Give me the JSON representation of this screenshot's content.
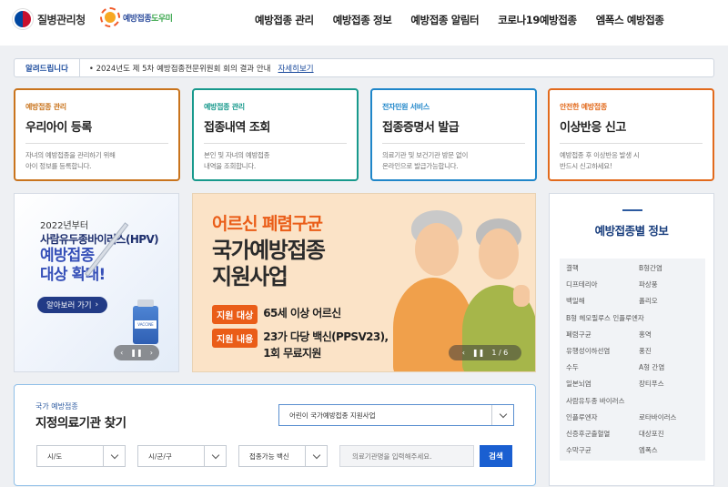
{
  "header": {
    "agency_name": "질병관리청",
    "service_logo_main": "예방접종",
    "service_logo_accent": "도우미",
    "nav": [
      "예방접종 관리",
      "예방접종 정보",
      "예방접종 알림터",
      "코로나19예방접종",
      "엠폭스 예방접종"
    ]
  },
  "notice": {
    "tag": "알려드립니다",
    "text": "• 2024년도 제 5차 예방접종전문위원회 회의 결과 안내",
    "link": "자세히보기"
  },
  "cards": [
    {
      "category": "예방접종 관리",
      "title": "우리아이 등록",
      "desc": "자녀의 예방접종을 관리하기 위해\n아이 정보를 등록합니다.",
      "color": "#c9741d"
    },
    {
      "category": "예방접종 관리",
      "title": "접종내역 조회",
      "desc": "본인 및 자녀의 예방접종\n내역을 조회합니다.",
      "color": "#17998c"
    },
    {
      "category": "전자민원 서비스",
      "title": "접종증명서 발급",
      "desc": "의료기관 및 보건기관 방문 없이\n온라인으로 발급가능합니다.",
      "color": "#1f86c9"
    },
    {
      "category": "안전한 예방접종",
      "title": "이상반응 신고",
      "desc": "예방접종 후 이상반응 발생 시\n반드시 신고하세요!",
      "color": "#e26a1c"
    }
  ],
  "hpv_banner": {
    "line1": "2022년부터",
    "line2": "사람유두종바이러스(HPV)",
    "line3": "예방접종\n대상 확대!",
    "button": "알아보러 가기",
    "vial_label": "VACCINE"
  },
  "main_banner": {
    "title1": "어르신 폐렴구균",
    "title2": "국가예방접종\n지원사업",
    "rows": [
      {
        "key": "지원 대상",
        "value": "65세 이상 어르신"
      },
      {
        "key": "지원 내용",
        "value": "23가 다당 백신(PPSV23),\n1회 무료지원"
      }
    ],
    "pager": "1 / 6"
  },
  "vaccine_info": {
    "title": "예방접종별 정보",
    "items": [
      "결핵",
      "B형간염",
      "디프테리아",
      "파상풍",
      "백일해",
      "폴리오",
      "B형 헤모필루스 인플루엔자",
      "",
      "폐렴구균",
      "홍역",
      "유행성이하선염",
      "풍진",
      "수두",
      "A형 간염",
      "일본뇌염",
      "장티푸스",
      "사람유두종 바이러스",
      "",
      "인플루엔자",
      "로타바이러스",
      "신증후군출혈열",
      "대상포진",
      "수막구균",
      "엠폭스"
    ]
  },
  "finder": {
    "category": "국가 예방접종",
    "title": "지정의료기관 찾기",
    "program": "어린이 국가예방접종 지원사업",
    "province": "시/도",
    "city": "시/군/구",
    "vaccine": "접종가능 백신",
    "placeholder": "의료기관명을 입력해주세요.",
    "search": "검색"
  },
  "colors": {
    "primary": "#1a5fd1",
    "banner_bg": "#fbe3c7",
    "banner_accent": "#ea5d18"
  }
}
